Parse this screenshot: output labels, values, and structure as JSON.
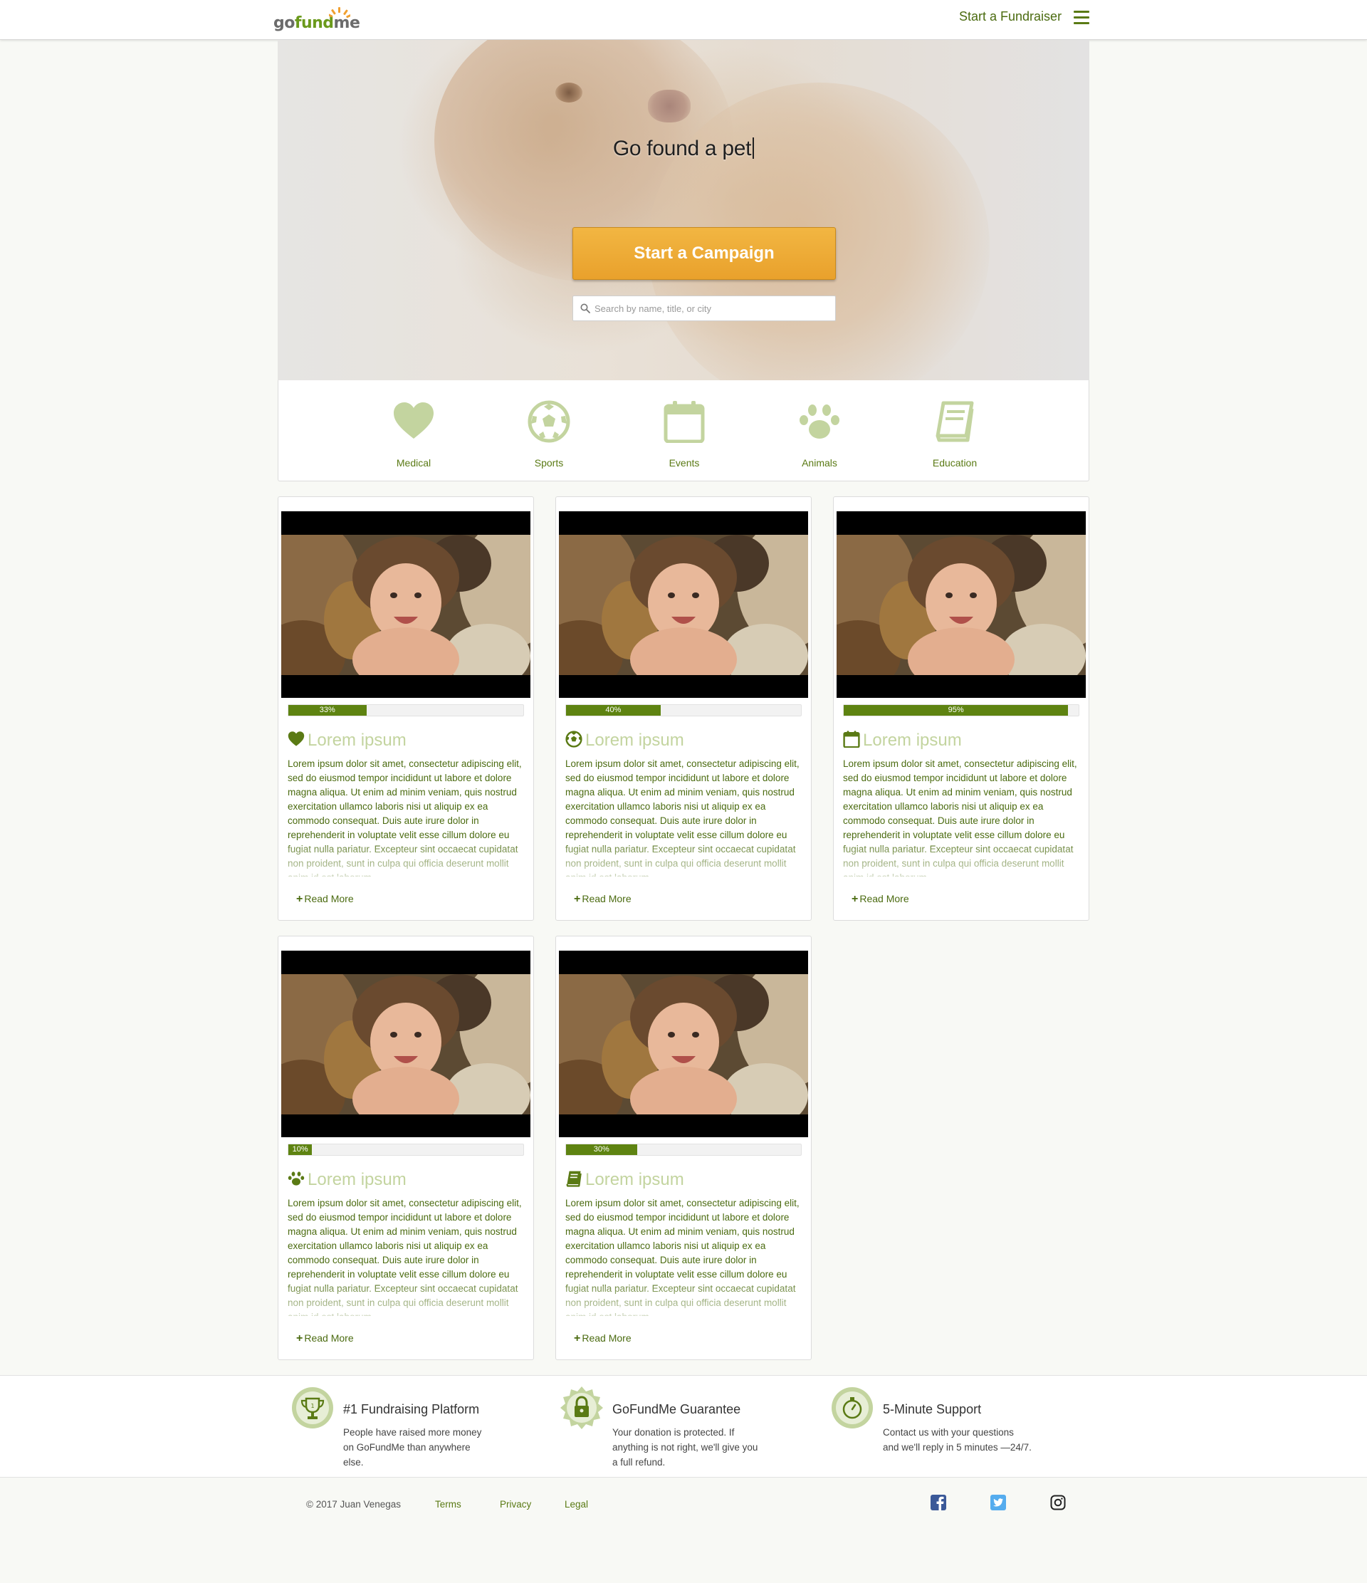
{
  "nav": {
    "logo": {
      "go": "go",
      "fund": "fund",
      "me": "me"
    },
    "start_fundraiser": "Start a Fundraiser",
    "menu_icon": "hamburger-icon"
  },
  "hero": {
    "title": "Go found a pet",
    "cta_label": "Start a Campaign",
    "search_placeholder": "Search by name, title, or city"
  },
  "categories": [
    {
      "label": "Medical",
      "icon": "heart-icon"
    },
    {
      "label": "Sports",
      "icon": "soccer-ball-icon"
    },
    {
      "label": "Events",
      "icon": "calendar-icon"
    },
    {
      "label": "Animals",
      "icon": "paw-icon"
    },
    {
      "label": "Education",
      "icon": "book-icon"
    }
  ],
  "cards": [
    {
      "progress": 33,
      "progress_label": "33%",
      "icon": "heart-icon",
      "title": "Lorem ipsum",
      "description": "Lorem ipsum dolor sit amet, consectetur adipiscing elit, sed do eiusmod tempor incididunt ut labore et dolore magna aliqua. Ut enim ad minim veniam, quis nostrud exercitation ullamco laboris nisi ut aliquip ex ea commodo consequat. Duis aute irure dolor in reprehenderit in voluptate velit esse cillum dolore eu fugiat nulla pariatur. Excepteur sint occaecat cupidatat non proident, sunt in culpa qui officia deserunt mollit anim id est laborum.",
      "read_more": "Read More"
    },
    {
      "progress": 40,
      "progress_label": "40%",
      "icon": "soccer-ball-icon",
      "title": "Lorem ipsum",
      "description": "Lorem ipsum dolor sit amet, consectetur adipiscing elit, sed do eiusmod tempor incididunt ut labore et dolore magna aliqua. Ut enim ad minim veniam, quis nostrud exercitation ullamco laboris nisi ut aliquip ex ea commodo consequat. Duis aute irure dolor in reprehenderit in voluptate velit esse cillum dolore eu fugiat nulla pariatur. Excepteur sint occaecat cupidatat non proident, sunt in culpa qui officia deserunt mollit anim id est laborum.",
      "read_more": "Read More"
    },
    {
      "progress": 95,
      "progress_label": "95%",
      "icon": "calendar-icon",
      "title": "Lorem ipsum",
      "description": "Lorem ipsum dolor sit amet, consectetur adipiscing elit, sed do eiusmod tempor incididunt ut labore et dolore magna aliqua. Ut enim ad minim veniam, quis nostrud exercitation ullamco laboris nisi ut aliquip ex ea commodo consequat. Duis aute irure dolor in reprehenderit in voluptate velit esse cillum dolore eu fugiat nulla pariatur. Excepteur sint occaecat cupidatat non proident, sunt in culpa qui officia deserunt mollit anim id est laborum.",
      "read_more": "Read More"
    },
    {
      "progress": 10,
      "progress_label": "10%",
      "icon": "paw-icon",
      "title": "Lorem ipsum",
      "description": "Lorem ipsum dolor sit amet, consectetur adipiscing elit, sed do eiusmod tempor incididunt ut labore et dolore magna aliqua. Ut enim ad minim veniam, quis nostrud exercitation ullamco laboris nisi ut aliquip ex ea commodo consequat. Duis aute irure dolor in reprehenderit in voluptate velit esse cillum dolore eu fugiat nulla pariatur. Excepteur sint occaecat cupidatat non proident, sunt in culpa qui officia deserunt mollit anim id est laborum.",
      "read_more": "Read More"
    },
    {
      "progress": 30,
      "progress_label": "30%",
      "icon": "book-icon",
      "title": "Lorem ipsum",
      "description": "Lorem ipsum dolor sit amet, consectetur adipiscing elit, sed do eiusmod tempor incididunt ut labore et dolore magna aliqua. Ut enim ad minim veniam, quis nostrud exercitation ullamco laboris nisi ut aliquip ex ea commodo consequat. Duis aute irure dolor in reprehenderit in voluptate velit esse cillum dolore eu fugiat nulla pariatur. Excepteur sint occaecat cupidatat non proident, sunt in culpa qui officia deserunt mollit anim id est laborum.",
      "read_more": "Read More"
    }
  ],
  "features": [
    {
      "icon": "trophy-icon",
      "title": "#1 Fundraising Platform",
      "text": "People have raised more money on GoFundMe than anywhere else."
    },
    {
      "icon": "lock-icon",
      "title": "GoFundMe Guarantee",
      "text": "Your donation is protected. If anything is not right, we'll give you a full refund."
    },
    {
      "icon": "stopwatch-icon",
      "title": "5-Minute Support",
      "text": "Contact us with your questions and we'll reply in 5 minutes —24/7."
    }
  ],
  "footer": {
    "copyright": "© 2017 Juan Venegas",
    "links": [
      "Terms",
      "Privacy",
      "Legal"
    ],
    "social": [
      "facebook-icon",
      "twitter-icon",
      "instagram-icon"
    ]
  },
  "colors": {
    "brand_green": "#5a7a14",
    "icon_green": "#c3d49f",
    "progress_green": "#5e8311",
    "cta_orange": "#eda935",
    "background": "#f8f9f5"
  }
}
